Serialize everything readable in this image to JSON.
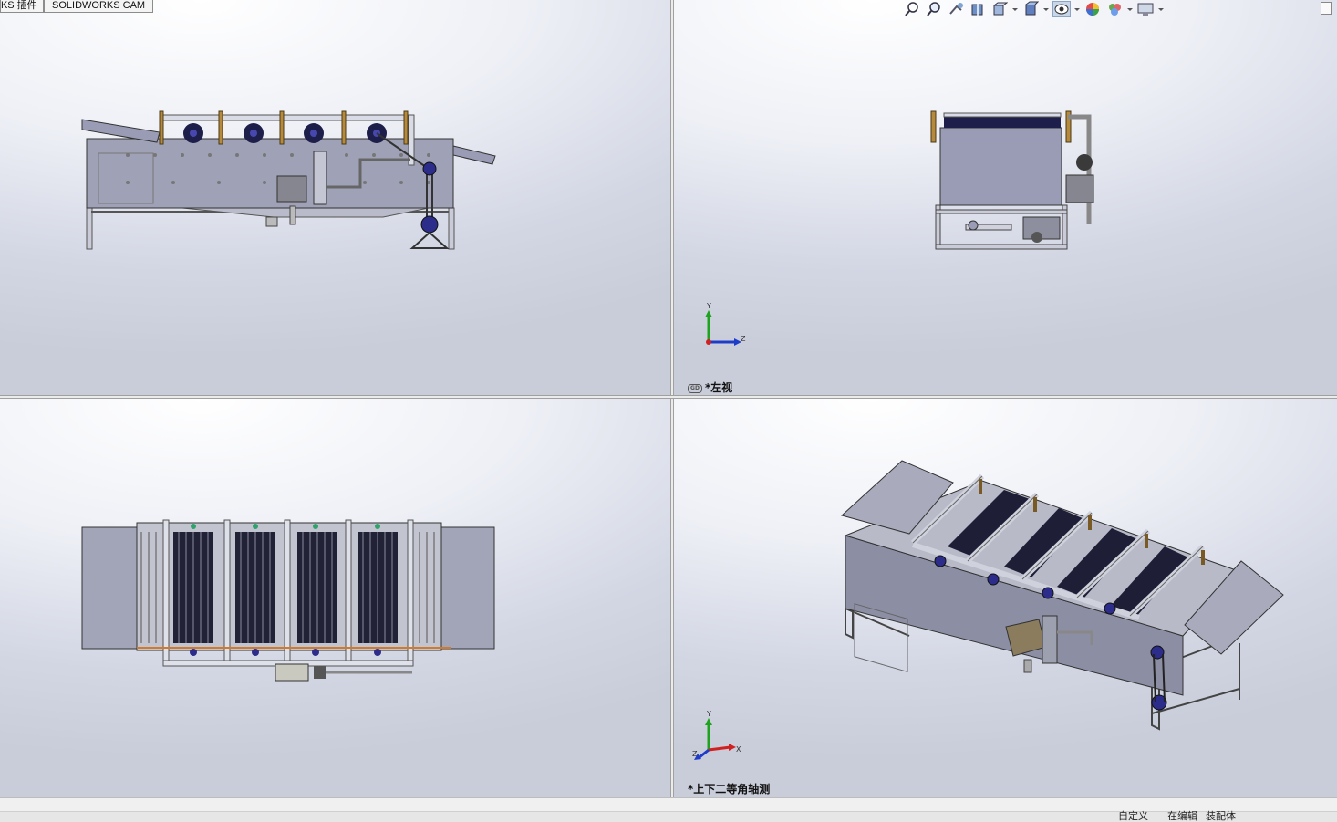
{
  "tabs": [
    {
      "label": "RKS 插件"
    },
    {
      "label": "SOLIDWORKS CAM"
    }
  ],
  "viewports": {
    "top_left": {
      "label": ""
    },
    "top_right": {
      "label": "*左视"
    },
    "bottom_left": {
      "label": ""
    },
    "bottom_right": {
      "label": "*上下二等角轴测"
    }
  },
  "triad": {
    "y": "Y",
    "z": "Z",
    "x": "X"
  },
  "toolbar": {
    "icons": [
      "zoom-to-fit-icon",
      "zoom-to-area-icon",
      "previous-view-icon",
      "section-view-icon",
      "view-orientation-icon",
      "display-style-icon",
      "hide-show-items-icon",
      "edit-appearance-icon",
      "apply-scene-icon",
      "view-settings-icon"
    ]
  },
  "status": {
    "left": "",
    "right_1": "自定义",
    "right_2": "在编辑",
    "right_3": "装配体"
  },
  "colors": {
    "steel": "#9a9cb5",
    "steel_dark": "#5b5d72",
    "frame": "#c7c9d6",
    "roller": "#1e1e4a",
    "pulley": "#2c2c8a",
    "background": "#e6e9f1"
  }
}
